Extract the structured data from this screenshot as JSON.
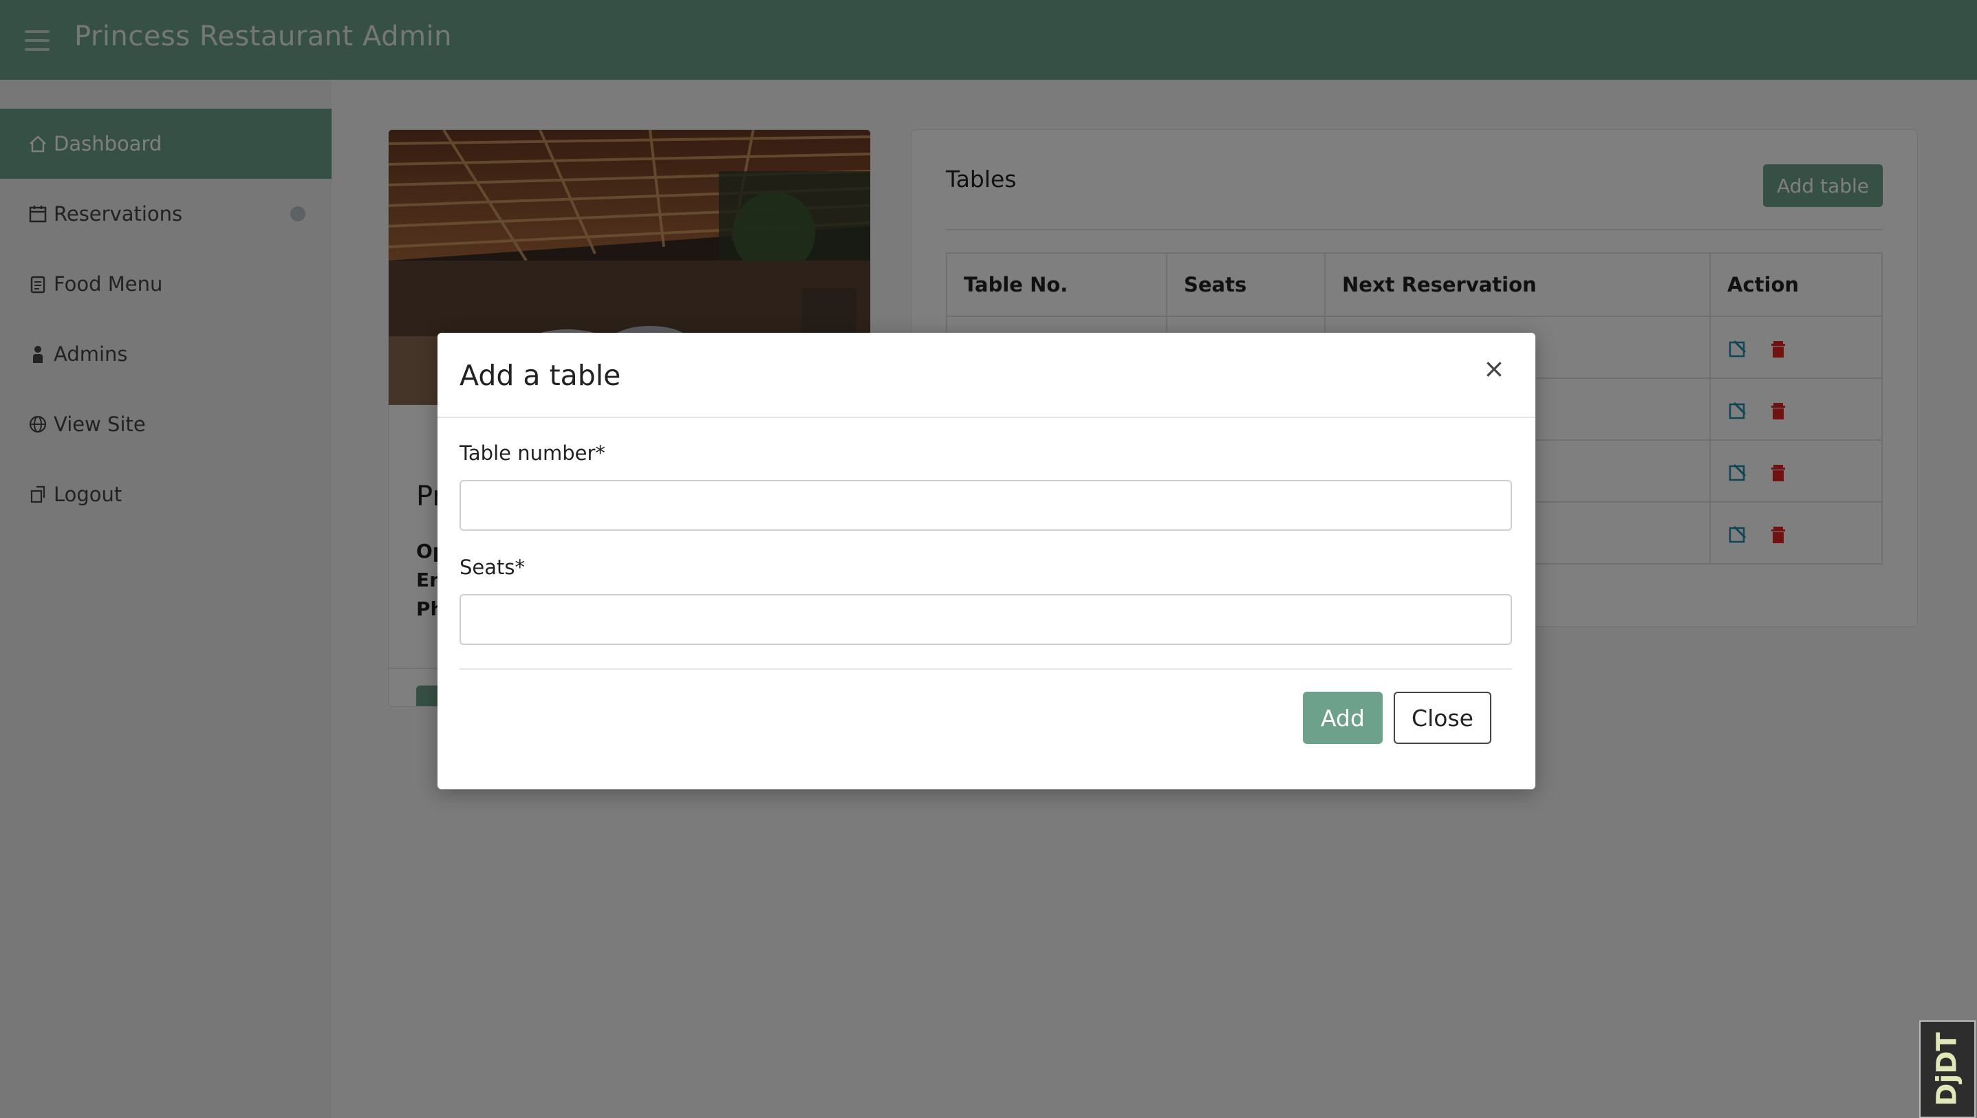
{
  "app": {
    "title": "Princess Restaurant Admin"
  },
  "sidebar": {
    "items": [
      {
        "label": "Dashboard",
        "icon": "home-icon",
        "active": true
      },
      {
        "label": "Reservations",
        "icon": "calendar-icon",
        "active": false
      },
      {
        "label": "Food Menu",
        "icon": "clipboard-icon",
        "active": false
      },
      {
        "label": "Admins",
        "icon": "person-icon",
        "active": false
      },
      {
        "label": "View Site",
        "icon": "globe-icon",
        "active": false
      },
      {
        "label": "Logout",
        "icon": "logout-icon",
        "active": false
      }
    ]
  },
  "restaurant_card": {
    "title": "Pr",
    "lines": [
      "Op",
      "En",
      "Ph"
    ]
  },
  "tables_panel": {
    "title": "Tables",
    "add_button": "Add table",
    "columns": [
      "Table No.",
      "Seats",
      "Next Reservation",
      "Action"
    ],
    "row_count": 4
  },
  "modal": {
    "title": "Add a table",
    "close_icon": "×",
    "fields": [
      {
        "label": "Table number*",
        "value": ""
      },
      {
        "label": "Seats*",
        "value": ""
      }
    ],
    "add_button": "Add",
    "close_button": "Close"
  },
  "corner_widget": {
    "label": "DjDT"
  },
  "colors": {
    "accent": "#6ea18c",
    "danger": "#e02424",
    "edit": "#1f8aa8",
    "overlay": "rgba(0,0,0,0.5)"
  }
}
